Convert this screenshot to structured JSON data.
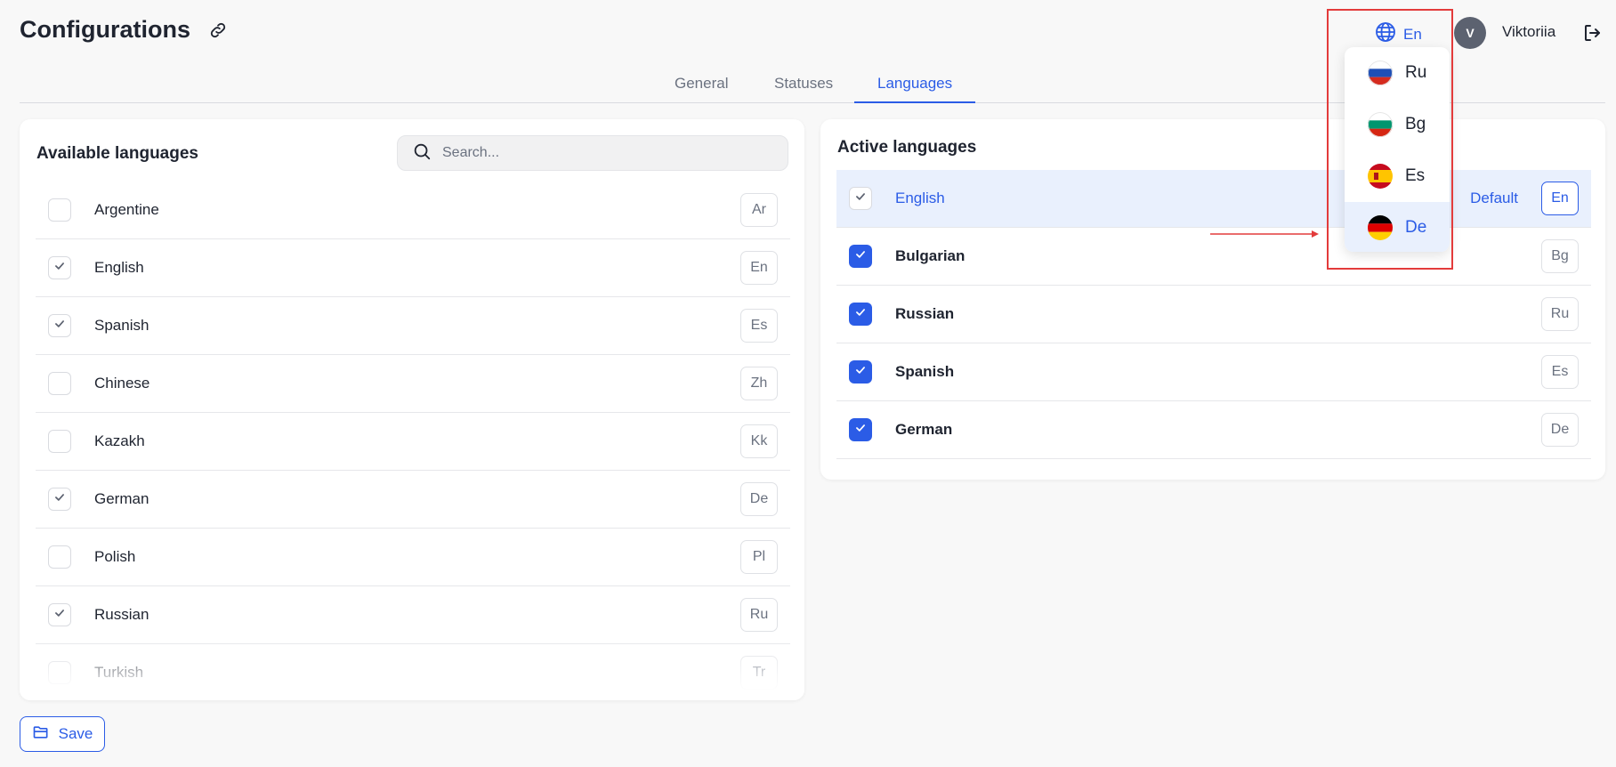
{
  "page": {
    "title": "Configurations"
  },
  "header": {
    "language": "En",
    "avatar_initial": "V",
    "username": "Viktoriia"
  },
  "tabs": [
    {
      "label": "General",
      "active": false
    },
    {
      "label": "Statuses",
      "active": false
    },
    {
      "label": "Languages",
      "active": true
    }
  ],
  "available": {
    "title": "Available languages",
    "search_placeholder": "Search...",
    "items": [
      {
        "label": "Argentine",
        "code": "Ar",
        "checked": false
      },
      {
        "label": "English",
        "code": "En",
        "checked": true
      },
      {
        "label": "Spanish",
        "code": "Es",
        "checked": true
      },
      {
        "label": "Chinese",
        "code": "Zh",
        "checked": false
      },
      {
        "label": "Kazakh",
        "code": "Kk",
        "checked": false
      },
      {
        "label": "German",
        "code": "De",
        "checked": true
      },
      {
        "label": "Polish",
        "code": "Pl",
        "checked": false
      },
      {
        "label": "Russian",
        "code": "Ru",
        "checked": true
      },
      {
        "label": "Turkish",
        "code": "Tr",
        "checked": false
      }
    ]
  },
  "active": {
    "title": "Active languages",
    "default_label": "Default",
    "items": [
      {
        "label": "English",
        "code": "En",
        "is_default": true
      },
      {
        "label": "Bulgarian",
        "code": "Bg",
        "is_default": false
      },
      {
        "label": "Russian",
        "code": "Ru",
        "is_default": false
      },
      {
        "label": "Spanish",
        "code": "Es",
        "is_default": false
      },
      {
        "label": "German",
        "code": "De",
        "is_default": false
      }
    ]
  },
  "dropdown": {
    "items": [
      {
        "label": "Ru",
        "flag": "flag-ru-icon",
        "selected": false
      },
      {
        "label": "Bg",
        "flag": "flag-bg-icon",
        "selected": false
      },
      {
        "label": "Es",
        "flag": "flag-es-icon",
        "selected": false
      },
      {
        "label": "De",
        "flag": "flag-de-icon",
        "selected": true
      }
    ]
  },
  "footer": {
    "save_label": "Save"
  },
  "colors": {
    "accent": "#2b5ce6",
    "highlight_bg": "#e9f0fd",
    "annotation_red": "#e33b3b",
    "avatar_bg": "#5c6270"
  }
}
